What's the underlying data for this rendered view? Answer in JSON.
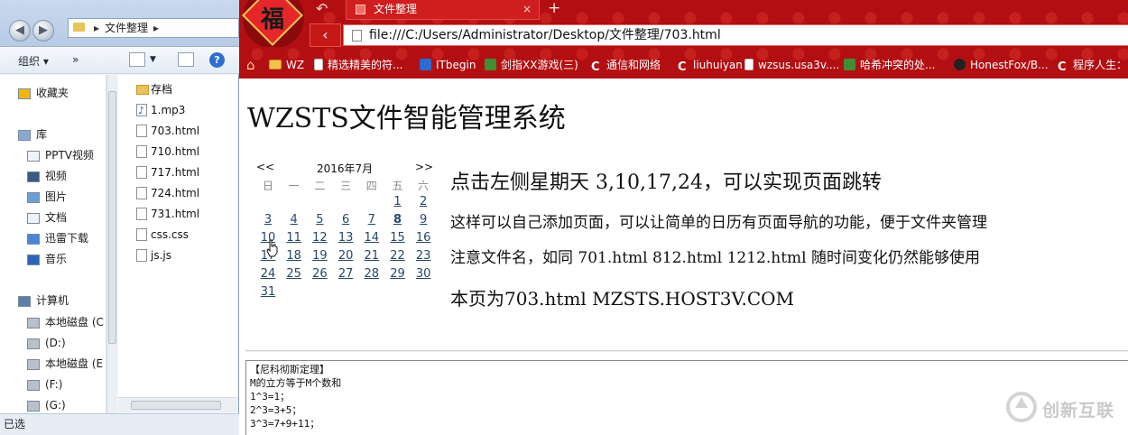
{
  "explorer": {
    "path": [
      "文件整理"
    ],
    "toolbar": {
      "organize": "组织 ▾",
      "more": "»"
    },
    "nav": [
      {
        "label": "收藏夹",
        "icon": "star-icon"
      },
      {
        "label": "库",
        "icon": "library-icon"
      },
      {
        "label": "PPTV视频",
        "icon": "document-icon"
      },
      {
        "label": "视频",
        "icon": "video-icon"
      },
      {
        "label": "图片",
        "icon": "picture-icon"
      },
      {
        "label": "文档",
        "icon": "document-icon"
      },
      {
        "label": "迅雷下载",
        "icon": "download-icon"
      },
      {
        "label": "音乐",
        "icon": "music-icon"
      },
      {
        "label": "计算机",
        "icon": "computer-icon"
      },
      {
        "label": "本地磁盘 (C",
        "icon": "drive-icon"
      },
      {
        "label": "(D:)",
        "icon": "drive-icon"
      },
      {
        "label": "本地磁盘 (E",
        "icon": "drive-icon"
      },
      {
        "label": "(F:)",
        "icon": "drive-icon"
      },
      {
        "label": "(G:)",
        "icon": "drive-icon"
      }
    ],
    "files": [
      {
        "name": "存档",
        "type": "folder"
      },
      {
        "name": "1.mp3",
        "type": "mp3"
      },
      {
        "name": "703.html",
        "type": "file"
      },
      {
        "name": "710.html",
        "type": "file"
      },
      {
        "name": "717.html",
        "type": "file"
      },
      {
        "name": "724.html",
        "type": "file"
      },
      {
        "name": "731.html",
        "type": "file"
      },
      {
        "name": "css.css",
        "type": "file"
      },
      {
        "name": "js.js",
        "type": "file"
      }
    ],
    "status": "已选"
  },
  "browser": {
    "tab_title": "文件整理",
    "tab_close": "×",
    "new_tab": "+",
    "url": "file:///C:/Users/Administrator/Desktop/文件整理/703.html",
    "bookmarks": [
      {
        "label": "WZ",
        "icon": "folder-icon"
      },
      {
        "label": "精选精美的符...",
        "icon": "page-icon"
      },
      {
        "label": "ITbegin",
        "icon": "itbegin-icon"
      },
      {
        "label": "剑指XX游戏(三)",
        "icon": "game-icon"
      },
      {
        "label": "通信和网络",
        "icon": "csdn-icon"
      },
      {
        "label": "liuhuiyan",
        "icon": "csdn-icon"
      },
      {
        "label": "wzsus.usa3v....",
        "icon": "page-icon"
      },
      {
        "label": "哈希冲突的处...",
        "icon": "game-icon"
      },
      {
        "label": "HonestFox/B...",
        "icon": "github-icon"
      },
      {
        "label": "程序人生：",
        "icon": "csdn-icon"
      }
    ]
  },
  "page": {
    "title": "WZSTS文件智能管理系统",
    "calendar": {
      "prev": "<<",
      "next": ">>",
      "month": "2016年7月",
      "weekdays": [
        "日",
        "一",
        "二",
        "三",
        "四",
        "五",
        "六"
      ],
      "first_weekday": 5,
      "days": 31,
      "linked_days": [
        3,
        10,
        17,
        24,
        31
      ],
      "bold_days": [
        8
      ]
    },
    "info": [
      "点击左侧星期天 3,10,17,24，可以实现页面跳转",
      "这样可以自己添加页面，可以让简单的日历有页面导航的功能，便于文件夹管理",
      "注意文件名，如同 701.html 812.html 1212.html 随时间变化仍然能够使用",
      "本页为703.html MZSTS.HOST3V.COM"
    ],
    "note_lines": [
      "【尼科彻斯定理】",
      "M的立方等于M个数和",
      "1^3=1；",
      "2^3=3+5；",
      "3^3=7+9+11；"
    ]
  },
  "watermark": "创新互联",
  "colors": {
    "chrome_red": "#b30f12",
    "link_blue": "#25476a"
  }
}
